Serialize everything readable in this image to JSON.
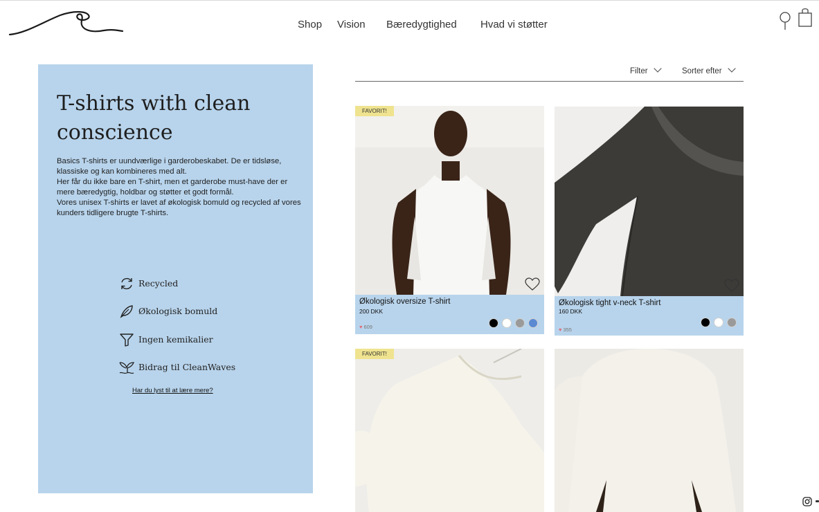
{
  "header": {
    "nav": [
      {
        "label": "Shop"
      },
      {
        "label": "Vision"
      },
      {
        "label": "Bæredygtighed"
      },
      {
        "label": "Hvad vi støtter"
      }
    ]
  },
  "intro": {
    "title": "T-shirts with clean conscience",
    "description": [
      "Basics T-shirts er uundværlige i garderobeskabet. De er tidsløse, klassiske og kan kombineres med alt.",
      "Her får du ikke bare en T-shirt, men et garderobe must-have der er mere bæredygtig, holdbar og støtter et godt formål.",
      "Vores unisex T-shirts er lavet af økologisk bomuld og recycled af vores kunders tidligere brugte T-shirts."
    ],
    "features": [
      {
        "label": "Recycled",
        "icon": "recycle-icon"
      },
      {
        "label": "Økologisk bomuld",
        "icon": "leaf-icon"
      },
      {
        "label": "Ingen kemikalier",
        "icon": "filter-icon"
      },
      {
        "label": "Bidrag til CleanWaves",
        "icon": "whale-tail-icon"
      }
    ],
    "learn_more": "Har du lyst til at lære mere?"
  },
  "toolbar": {
    "filter_label": "Filter",
    "sort_label": "Sorter efter"
  },
  "products": [
    {
      "badge": "FAVORIT!",
      "name": "Økologisk oversize T-shirt",
      "price": "200 DKK",
      "likes": "609",
      "swatches": [
        "#000000",
        "#ffffff",
        "#9a9a9a",
        "#5b8ad3"
      ]
    },
    {
      "badge": "",
      "name": "Økologisk tight v-neck T-shirt",
      "price": "160 DKK",
      "likes": "355",
      "swatches": [
        "#000000",
        "#ffffff",
        "#9a9a9a"
      ]
    },
    {
      "badge": "FAVORIT!",
      "name": "",
      "price": "",
      "likes": "",
      "swatches": []
    },
    {
      "badge": "",
      "name": "",
      "price": "",
      "likes": "",
      "swatches": []
    }
  ],
  "colors": {
    "panel": "#b8d4ec",
    "badge": "#efe38f"
  }
}
